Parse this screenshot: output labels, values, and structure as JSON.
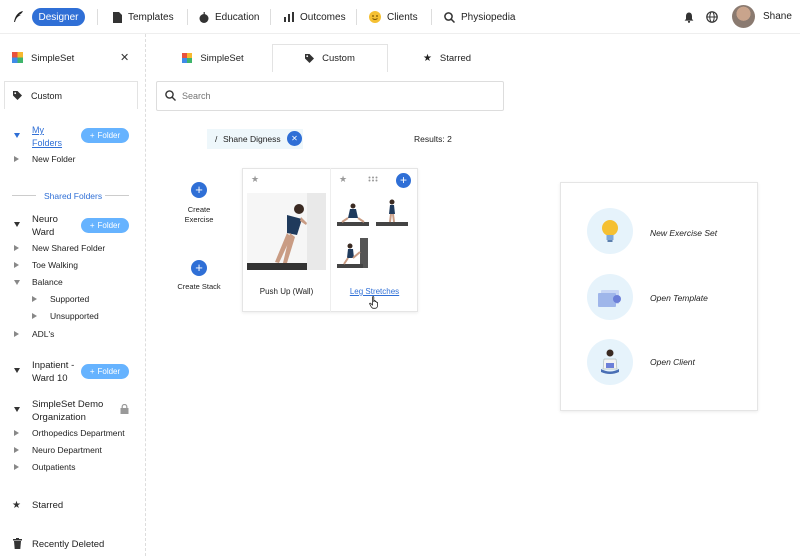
{
  "nav": {
    "designer": "Designer",
    "templates": "Templates",
    "education": "Education",
    "outcomes": "Outcomes",
    "clients": "Clients",
    "physiopedia": "Physiopedia",
    "user": "Shane"
  },
  "sidebar": {
    "app_name": "SimpleSet",
    "custom": "Custom",
    "my_folders": "My Folders",
    "folder_button": "Folder",
    "new_folder": "New Folder",
    "shared_folders": "Shared Folders",
    "neuro_ward": "Neuro Ward",
    "new_shared_folder": "New Shared Folder",
    "toe_walking": "Toe Walking",
    "balance": "Balance",
    "supported": "Supported",
    "unsupported": "Unsupported",
    "adls": "ADL's",
    "inpatient": "Inpatient - Ward 10",
    "demo_org": "SimpleSet Demo Organization",
    "orthopedics": "Orthopedics Department",
    "neuro_dept": "Neuro Department",
    "outpatients": "Outpatients",
    "starred": "Starred",
    "recently_deleted": "Recently Deleted"
  },
  "tabs": {
    "simpleset": "SimpleSet",
    "custom": "Custom",
    "starred": "Starred"
  },
  "search": {
    "placeholder": "Search"
  },
  "breadcrumb": {
    "slash": "/",
    "name": "Shane Digness"
  },
  "results": "Results: 2",
  "actions": {
    "create_exercise": "Create Exercise",
    "create_stack": "Create Stack"
  },
  "exercises": [
    {
      "name": "Push Up (Wall)"
    },
    {
      "name": "Leg Stretches"
    }
  ],
  "quick_actions": {
    "new_exercise_set": "New Exercise Set",
    "open_template": "Open Template",
    "open_client": "Open Client"
  },
  "colors": {
    "primary": "#2f6fd6",
    "pill": "#66b3ff",
    "soft": "#e6f3fb"
  }
}
